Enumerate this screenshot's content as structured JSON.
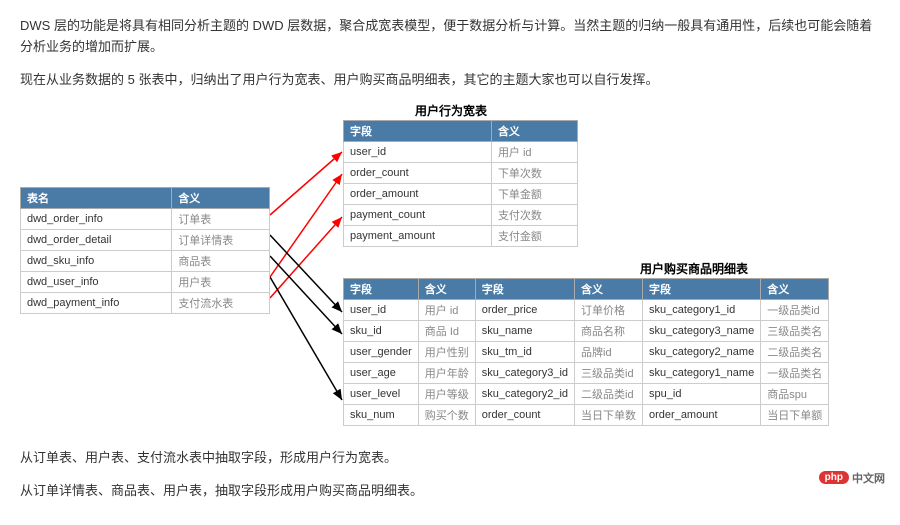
{
  "text": {
    "p1": "DWS 层的功能是将具有相同分析主题的 DWD 层数据，聚合成宽表模型，便于数据分析与计算。当然主题的归纳一般具有通用性，后续也可能会随着分析业务的增加而扩展。",
    "p2": "现在从业务数据的 5 张表中，归纳出了用户行为宽表、用户购买商品明细表，其它的主题大家也可以自行发挥。",
    "p3": "从订单表、用户表、支付流水表中抽取字段，形成用户行为宽表。",
    "p4": "从订单详情表、商品表、用户表，抽取字段形成用户购买商品明细表。"
  },
  "captions": {
    "behavior": "用户行为宽表",
    "detail": "用户购买商品明细表"
  },
  "source_table": {
    "headers": [
      "表名",
      "含义"
    ],
    "rows": [
      [
        "dwd_order_info",
        "订单表"
      ],
      [
        "dwd_order_detail",
        "订单详情表"
      ],
      [
        "dwd_sku_info",
        "商品表"
      ],
      [
        "dwd_user_info",
        "用户表"
      ],
      [
        "dwd_payment_info",
        "支付流水表"
      ]
    ]
  },
  "behavior_table": {
    "headers": [
      "字段",
      "含义"
    ],
    "rows": [
      [
        "user_id",
        "用户 id"
      ],
      [
        "order_count",
        "下单次数"
      ],
      [
        "order_amount",
        "下单金额"
      ],
      [
        "payment_count",
        "支付次数"
      ],
      [
        "payment_amount",
        "支付金额"
      ]
    ]
  },
  "detail_table": {
    "headers": [
      "字段",
      "含义",
      "字段",
      "含义",
      "字段",
      "含义"
    ],
    "rows": [
      [
        "user_id",
        "用户 id",
        "order_price",
        "订单价格",
        "sku_category1_id",
        "一级品类id"
      ],
      [
        "sku_id",
        "商品 Id",
        "sku_name",
        "商品名称",
        "sku_category3_name",
        "三级品类名"
      ],
      [
        "user_gender",
        "用户性别",
        "sku_tm_id",
        "品牌id",
        "sku_category2_name",
        "二级品类名"
      ],
      [
        "user_age",
        "用户年龄",
        "sku_category3_id",
        "三级品类id",
        "sku_category1_name",
        "一级品类名"
      ],
      [
        "user_level",
        "用户等级",
        "sku_category2_id",
        "二级品类id",
        "spu_id",
        "商品spu"
      ],
      [
        "sku_num",
        "购买个数",
        "order_count",
        "当日下单数",
        "order_amount",
        "当日下单额"
      ]
    ]
  },
  "logo": {
    "badge": "php",
    "text": "中文网"
  }
}
